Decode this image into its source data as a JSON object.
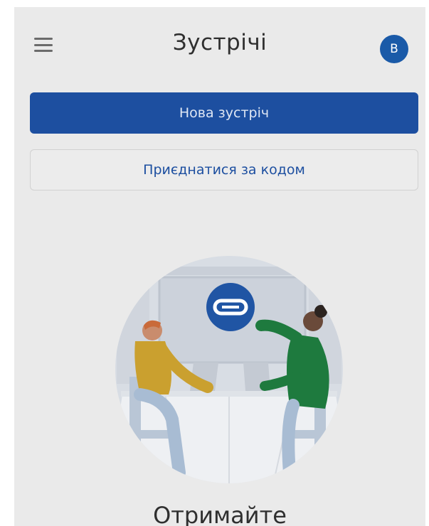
{
  "header": {
    "title": "Зустрічі",
    "avatar_letter": "В",
    "menu_icon": "hamburger-menu-icon"
  },
  "actions": {
    "new_meeting": "Нова зустріч",
    "join_by_code": "Приєднатися за кодом"
  },
  "illustration": {
    "center_icon": "link-icon"
  },
  "promo": {
    "heading": "Отримайте"
  },
  "colors": {
    "primary": "#1d4fa0",
    "screen_bg": "#eaeaea",
    "avatar_bg": "#1a5aa8"
  }
}
